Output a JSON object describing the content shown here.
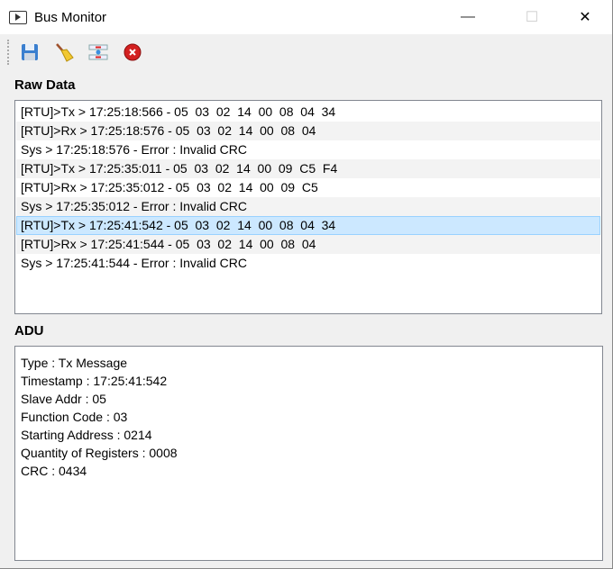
{
  "window": {
    "title": "Bus Monitor",
    "minimize": "—",
    "maximize": "☐",
    "close": "✕"
  },
  "toolbar": {
    "buttons": [
      {
        "icon": "save-icon"
      },
      {
        "icon": "broom-icon"
      },
      {
        "icon": "settings-icon"
      },
      {
        "icon": "stop-icon"
      }
    ]
  },
  "raw_data": {
    "label": "Raw Data",
    "rows": [
      "[RTU]>Tx > 17:25:18:566 - 05  03  02  14  00  08  04  34",
      "[RTU]>Rx > 17:25:18:576 - 05  03  02  14  00  08  04",
      "Sys > 17:25:18:576 - Error : Invalid CRC",
      "[RTU]>Tx > 17:25:35:011 - 05  03  02  14  00  09  C5  F4",
      "[RTU]>Rx > 17:25:35:012 - 05  03  02  14  00  09  C5",
      "Sys > 17:25:35:012 - Error : Invalid CRC",
      "[RTU]>Tx > 17:25:41:542 - 05  03  02  14  00  08  04  34",
      "[RTU]>Rx > 17:25:41:544 - 05  03  02  14  00  08  04",
      "Sys > 17:25:41:544 - Error : Invalid CRC"
    ],
    "selected_index": 6
  },
  "adu": {
    "label": "ADU",
    "lines": [
      "Type : Tx Message",
      "Timestamp : 17:25:41:542",
      "Slave Addr : 05",
      "Function Code : 03",
      "Starting Address : 0214",
      "Quantity of Registers : 0008",
      "CRC : 0434"
    ]
  }
}
